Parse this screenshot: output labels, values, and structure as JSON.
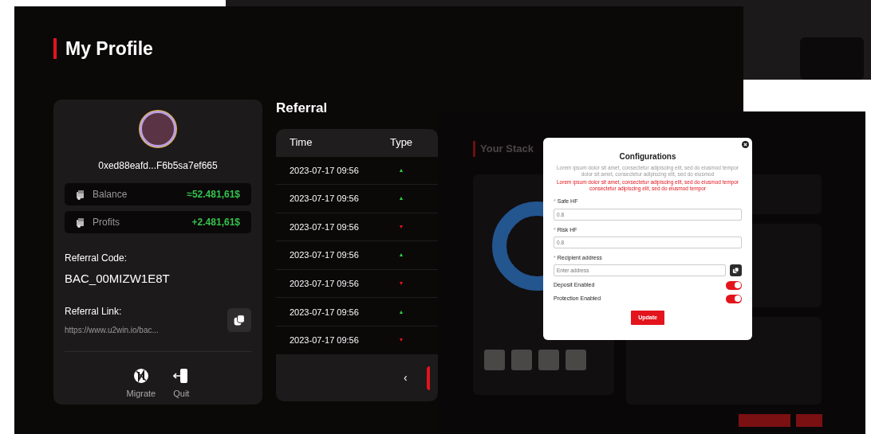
{
  "profile_page": {
    "title": "My Profile"
  },
  "profile": {
    "address": "0xed88eafd...F6b5sa7ef665",
    "stats": [
      {
        "label": "Balance",
        "value": "≈52.481,61$"
      },
      {
        "label": "Profits",
        "value": "+2.481,61$"
      }
    ],
    "referral_code_label": "Referral Code:",
    "referral_code": "BAC_00MIZW1E8T",
    "referral_link_label": "Referral Link:",
    "referral_link": "https://www.u2win.io/bac...",
    "actions": [
      {
        "label": "Migrate",
        "kind": "migrate"
      },
      {
        "label": "Quit",
        "kind": "quit"
      }
    ]
  },
  "referral": {
    "title": "Referral",
    "columns": [
      "Time",
      "Type"
    ],
    "rows": [
      {
        "time": "2023-07-17 09:56",
        "type": "▲",
        "rising": true
      },
      {
        "time": "2023-07-17 09:56",
        "type": "▲",
        "rising": true
      },
      {
        "time": "2023-07-17 09:56",
        "type": "▼",
        "rising": false
      },
      {
        "time": "2023-07-17 09:56",
        "type": "▲",
        "rising": true
      },
      {
        "time": "2023-07-17 09:56",
        "type": "▼",
        "rising": false
      },
      {
        "time": "2023-07-17 09:56",
        "type": "▲",
        "rising": true
      },
      {
        "time": "2023-07-17 09:56",
        "type": "▼",
        "rising": false
      }
    ],
    "previous_page": "‹"
  },
  "stack_screen": {
    "title": "Your Stack",
    "modal": {
      "title": "Configurations",
      "description": "Lorem ipsum dolor sit amet, consectetur adipiscing elit, sed do eiusmod tempor dolor sit amet, consectetur adipiscing elit, sed do eiusmod",
      "warning": "Lorem ipsum dolor sit amet, consectetur adipiscing elit, sed do eiusmod tempor consectetur adipiscing elit, sed do eiusmod tempor",
      "fields": [
        {
          "marker": "*",
          "label": "Safe HF",
          "placeholder": "0.8",
          "kind": "plain"
        },
        {
          "marker": "*",
          "label": "Risk HF",
          "placeholder": "0.8",
          "kind": "plain"
        },
        {
          "marker": "*",
          "label": "Recipient address",
          "placeholder": "Enter address",
          "kind": "copy"
        }
      ],
      "toggles": [
        {
          "label": "Deposit Enabled",
          "on": true
        },
        {
          "label": "Protection Enabled",
          "on": true
        }
      ],
      "button": "Update"
    }
  }
}
